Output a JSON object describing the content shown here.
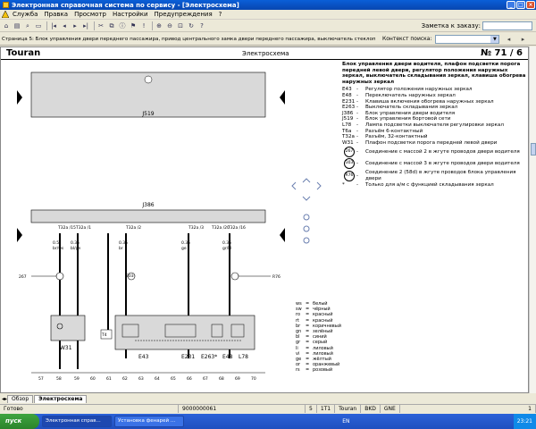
{
  "window": {
    "title": "Электронная справочная система по сервису - [Электросхема]"
  },
  "menu": {
    "items": [
      "Служба",
      "Правка",
      "Просмотр",
      "Настройки",
      "Предупреждения",
      "?"
    ]
  },
  "toolbar": {
    "order_label": "Заметка к заказу:",
    "order_value": ""
  },
  "breadcrumb": {
    "text": "Страница 5: Блок управления двери переднего пассажира, привод центрального замка двери переднего пассажира, выключатель стеклоподъемника на двери",
    "context_label": "Контекст поиска:",
    "context_value": ""
  },
  "document": {
    "brand": "Touran",
    "type": "Электросхема",
    "page": "№  71 / 6",
    "legend_title": "Блок управления двери водителя, плафон подсветки порога передней левой двери, регулятор положения наружных зеркал, выключатель складывания зеркал, клавиша обогрева наружных зеркал",
    "legend": [
      {
        "code": "E43",
        "text": "Регулятор положения наружных зеркал"
      },
      {
        "code": "E48",
        "text": "Переключатель наружных зеркал"
      },
      {
        "code": "E231",
        "text": "Клавиша включения обогрева наружных зеркал"
      },
      {
        "code": "E263",
        "text": "Выключатель складывания зеркал"
      },
      {
        "code": "J386",
        "text": "Блок управления двери водителя"
      },
      {
        "code": "J519",
        "text": "Блок управления бортовой сети"
      },
      {
        "code": "L78",
        "text": "Лампа подсветки выключателя регулировки зеркал"
      },
      {
        "code": "T6a",
        "text": "Разъём 6-контактный"
      },
      {
        "code": "T32a",
        "text": "Разъём, 32-контактный"
      },
      {
        "code": "W31",
        "text": "Плафон подсветки порога передней левой двери"
      }
    ],
    "legend_grounds": [
      {
        "code": "267",
        "text": "Соединение с массой 2 в жгуте проводов двери водителя"
      },
      {
        "code": "303",
        "text": "Соединение с массой 3 в жгуте проводов двери водителя"
      },
      {
        "code": "R76",
        "text": "Соединение 2 (58d) в жгуте проводов блока управления двери"
      }
    ],
    "legend_note": {
      "code": "*",
      "text": "Только для а/м с функцией складывания зеркал"
    },
    "diagram": {
      "top_block": "J519",
      "main_block": "J386",
      "pins": [
        "T32a\n/15",
        "T32a\n/1",
        "T32a\n/2",
        "T32a\n/3",
        "T32a\n/20",
        "T32a\n/16"
      ],
      "labels": {
        "wire1_size": "0.5",
        "wire1_color": "br/ws",
        "wire2_size": "0.35",
        "wire2_color": "bl/gn",
        "wire3_size": "0.35",
        "wire3_color": "br",
        "wire4_size": "0.35",
        "wire4_color": "ws/ro",
        "wire5_size": "0.35",
        "wire5_color": "ge",
        "wire6_size": "0.35",
        "wire6_color": "gr/bl",
        "ground_left": "267",
        "ground_mid": "303",
        "conn_right": "R76",
        "right_label": "R76",
        "w31": "W31",
        "e43": "E43",
        "e231": "E231",
        "e263": "E263*",
        "e48": "E48",
        "l78": "L78",
        "t6a_pins": [
          "T6a/2",
          "T6a/1",
          "T6a/3",
          "T6a/5",
          "T6a/6"
        ],
        "t4": "T4"
      },
      "ruler": [
        "57",
        "58",
        "59",
        "60",
        "61",
        "62",
        "63",
        "64",
        "65",
        "66",
        "67",
        "68",
        "69",
        "70"
      ]
    },
    "colors": [
      {
        "code": "ws",
        "name": "белый"
      },
      {
        "code": "sw",
        "name": "чёрный"
      },
      {
        "code": "ro",
        "name": "красный"
      },
      {
        "code": "rt",
        "name": "красный"
      },
      {
        "code": "br",
        "name": "коричневый"
      },
      {
        "code": "gn",
        "name": "зелёный"
      },
      {
        "code": "bl",
        "name": "синий"
      },
      {
        "code": "gr",
        "name": "серый"
      },
      {
        "code": "li",
        "name": "лиловый"
      },
      {
        "code": "vi",
        "name": "лиловый"
      },
      {
        "code": "ge",
        "name": "жёлтый"
      },
      {
        "code": "or",
        "name": "оранжевый"
      },
      {
        "code": "rs",
        "name": "розовый"
      }
    ]
  },
  "tabs": [
    "Обзор",
    "Электросхема"
  ],
  "status": {
    "ready": "Готово",
    "order_number": "9000000061",
    "cells": [
      "5",
      "1T1",
      "Touran",
      "BKD",
      "GNE"
    ],
    "page": "1"
  },
  "taskbar": {
    "start": "пуск",
    "tasks": [
      "Электронная справ...",
      "Установка фенарей ..."
    ],
    "lang": "EN",
    "clock": "23:21"
  }
}
